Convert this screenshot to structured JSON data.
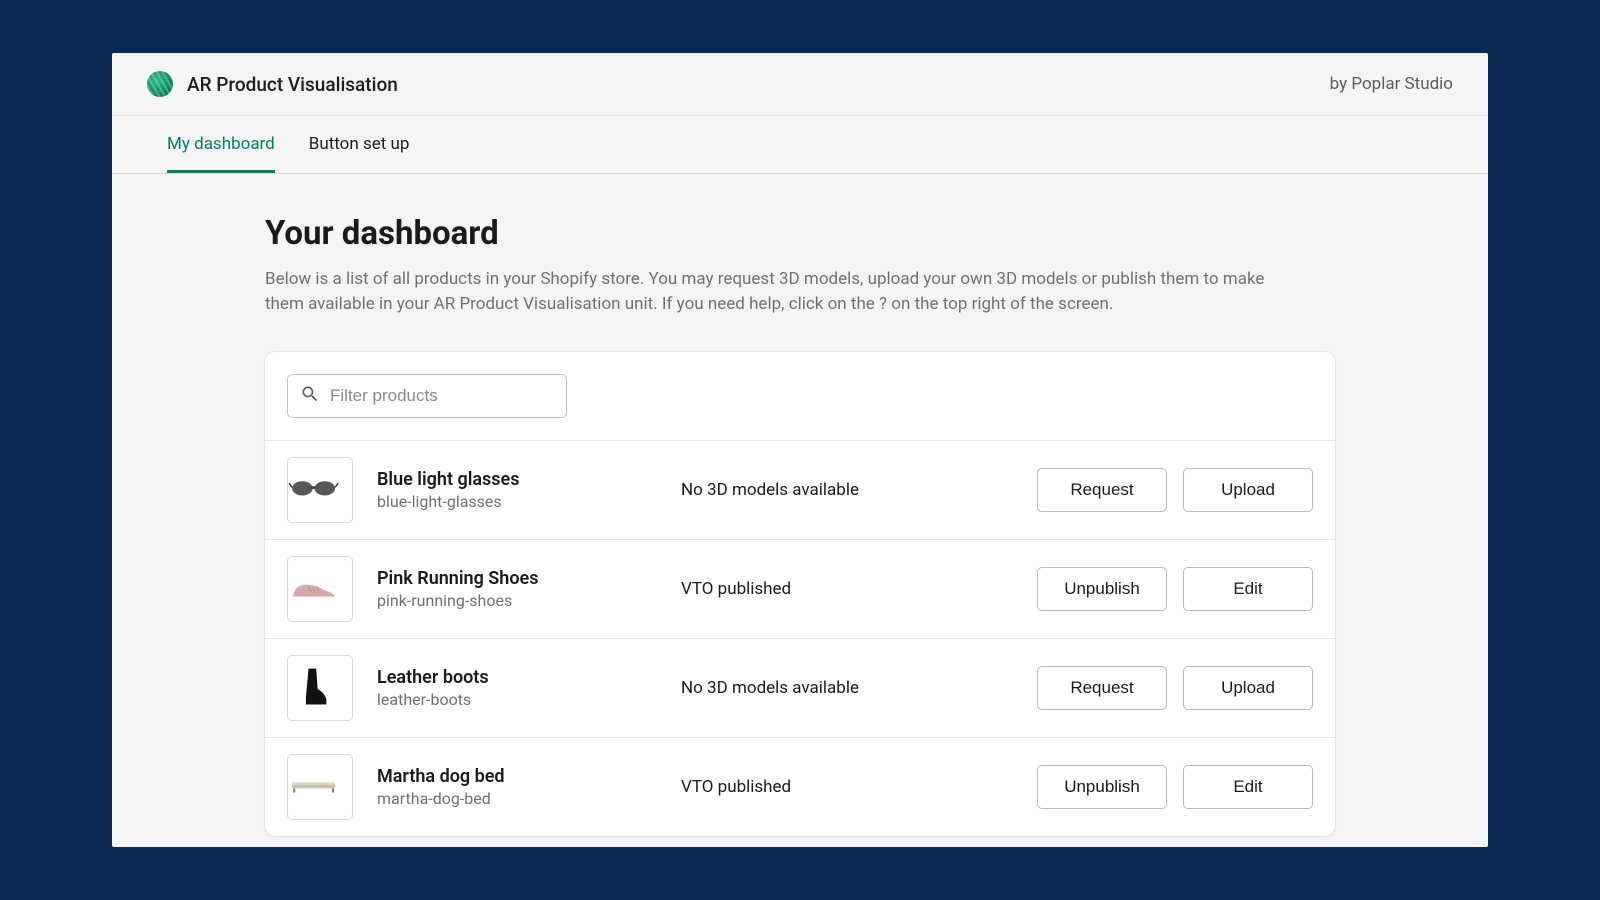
{
  "header": {
    "app_title": "AR Product Visualisation",
    "byline": "by Poplar Studio"
  },
  "tabs": [
    {
      "label": "My dashboard",
      "active": true
    },
    {
      "label": "Button set up",
      "active": false
    }
  ],
  "page": {
    "title": "Your dashboard",
    "description": "Below is a list of all products in your Shopify store. You may request 3D models, upload your own 3D models or publish them to make them available in your AR Product Visualisation unit. If you need help, click on the ? on the top right of the screen."
  },
  "filter": {
    "placeholder": "Filter products",
    "value": ""
  },
  "products": [
    {
      "name": "Blue light glasses",
      "slug": "blue-light-glasses",
      "status": "No 3D models available",
      "action1": "Request",
      "action2": "Upload",
      "icon": "glasses"
    },
    {
      "name": "Pink Running Shoes",
      "slug": "pink-running-shoes",
      "status": "VTO published",
      "action1": "Unpublish",
      "action2": "Edit",
      "icon": "pink-shoe"
    },
    {
      "name": "Leather boots",
      "slug": "leather-boots",
      "status": "No 3D models available",
      "action1": "Request",
      "action2": "Upload",
      "icon": "boot"
    },
    {
      "name": "Martha dog bed",
      "slug": "martha-dog-bed",
      "status": "VTO published",
      "action1": "Unpublish",
      "action2": "Edit",
      "icon": "dog-bed"
    }
  ]
}
